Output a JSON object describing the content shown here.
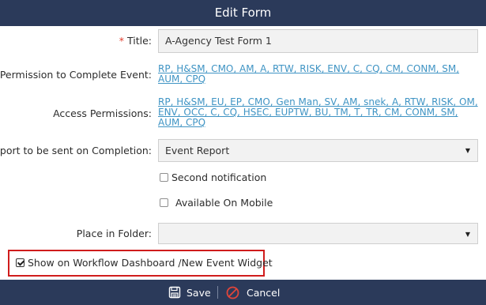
{
  "dialog": {
    "title": "Edit Form"
  },
  "form": {
    "title_label": "Title:",
    "required_mark": "*",
    "title_value": "A-Agency Test Form 1",
    "perm_complete_label": "Permission to Complete Event:",
    "perm_complete_value": "RP, H&SM, CMO, AM, A, RTW, RISK, ENV, C, CQ, CM, CONM, SM, AUM, CPQ",
    "access_perm_label": "Access Permissions:",
    "access_perm_value": "RP, H&SM, EU, EP, CMO, Gen Man, SV, AM, snek, A, RTW, RISK, OM, ENV, OCC, C, CQ, HSEC, EUPTW, BU, TM, T, TR, CM, CONM, SM, AUM, CPQ",
    "report_label": "Report to be sent on Completion:",
    "report_value": "Event Report",
    "second_notification_label": "Second notification",
    "available_mobile_label": "Available On Mobile",
    "folder_label": "Place in Folder:",
    "folder_value": "",
    "show_dashboard_label": "Show on Workflow Dashboard /New Event Widget"
  },
  "footer": {
    "save_label": "Save",
    "cancel_label": "Cancel"
  },
  "icons": {
    "save": "floppy-disk-icon",
    "cancel": "cancel-circle-icon",
    "dropdown": "caret-down-icon"
  },
  "colors": {
    "header_bg": "#2b3a5a",
    "link": "#3f94c4",
    "required": "#e23c2c",
    "highlight": "#d01c1c"
  }
}
